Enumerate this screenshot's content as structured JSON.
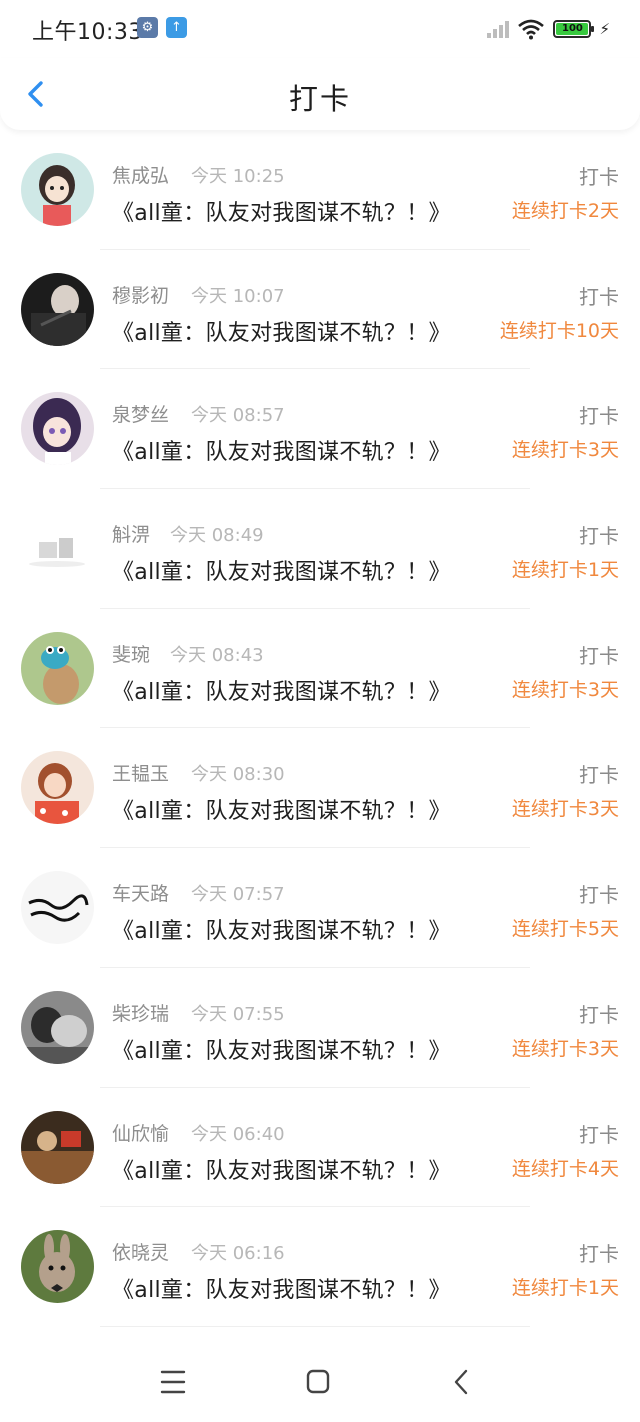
{
  "status_bar": {
    "time": "上午10:33",
    "battery": "100",
    "icons": [
      "settings-icon",
      "upload-icon",
      "signal-icon",
      "wifi-icon",
      "battery-icon",
      "charging-icon"
    ]
  },
  "header": {
    "title": "打卡",
    "back_icon": "chevron-left-icon"
  },
  "items": [
    {
      "name": "焦成弘",
      "time": "今天 10:25",
      "title": "《all童：队友对我图谋不轨？！》",
      "tag": "打卡",
      "streak": "连续打卡2天"
    },
    {
      "name": "穆影初",
      "time": "今天 10:07",
      "title": "《all童：队友对我图谋不轨？！》",
      "tag": "打卡",
      "streak": "连续打卡10天"
    },
    {
      "name": "泉梦丝",
      "time": "今天 08:57",
      "title": "《all童：队友对我图谋不轨？！》",
      "tag": "打卡",
      "streak": "连续打卡3天"
    },
    {
      "name": "斛淠",
      "time": "今天 08:49",
      "title": "《all童：队友对我图谋不轨？！》",
      "tag": "打卡",
      "streak": "连续打卡1天"
    },
    {
      "name": "斐琬",
      "time": "今天 08:43",
      "title": "《all童：队友对我图谋不轨？！》",
      "tag": "打卡",
      "streak": "连续打卡3天"
    },
    {
      "name": "王韫玉",
      "time": "今天 08:30",
      "title": "《all童：队友对我图谋不轨？！》",
      "tag": "打卡",
      "streak": "连续打卡3天"
    },
    {
      "name": "车天路",
      "time": "今天 07:57",
      "title": "《all童：队友对我图谋不轨？！》",
      "tag": "打卡",
      "streak": "连续打卡5天"
    },
    {
      "name": "柴珍瑞",
      "time": "今天 07:55",
      "title": "《all童：队友对我图谋不轨？！》",
      "tag": "打卡",
      "streak": "连续打卡3天"
    },
    {
      "name": "仙欣愉",
      "time": "今天 06:40",
      "title": "《all童：队友对我图谋不轨？！》",
      "tag": "打卡",
      "streak": "连续打卡4天"
    },
    {
      "name": "依晓灵",
      "time": "今天 06:16",
      "title": "《all童：队友对我图谋不轨？！》",
      "tag": "打卡",
      "streak": "连续打卡1天"
    }
  ],
  "navbar": {
    "icons": [
      "menu-icon",
      "home-icon",
      "back-icon"
    ]
  },
  "colors": {
    "accent": "#2f8ff0",
    "streak": "#f0883e",
    "name": "#8e8e8e",
    "time": "#b7b7b7"
  }
}
